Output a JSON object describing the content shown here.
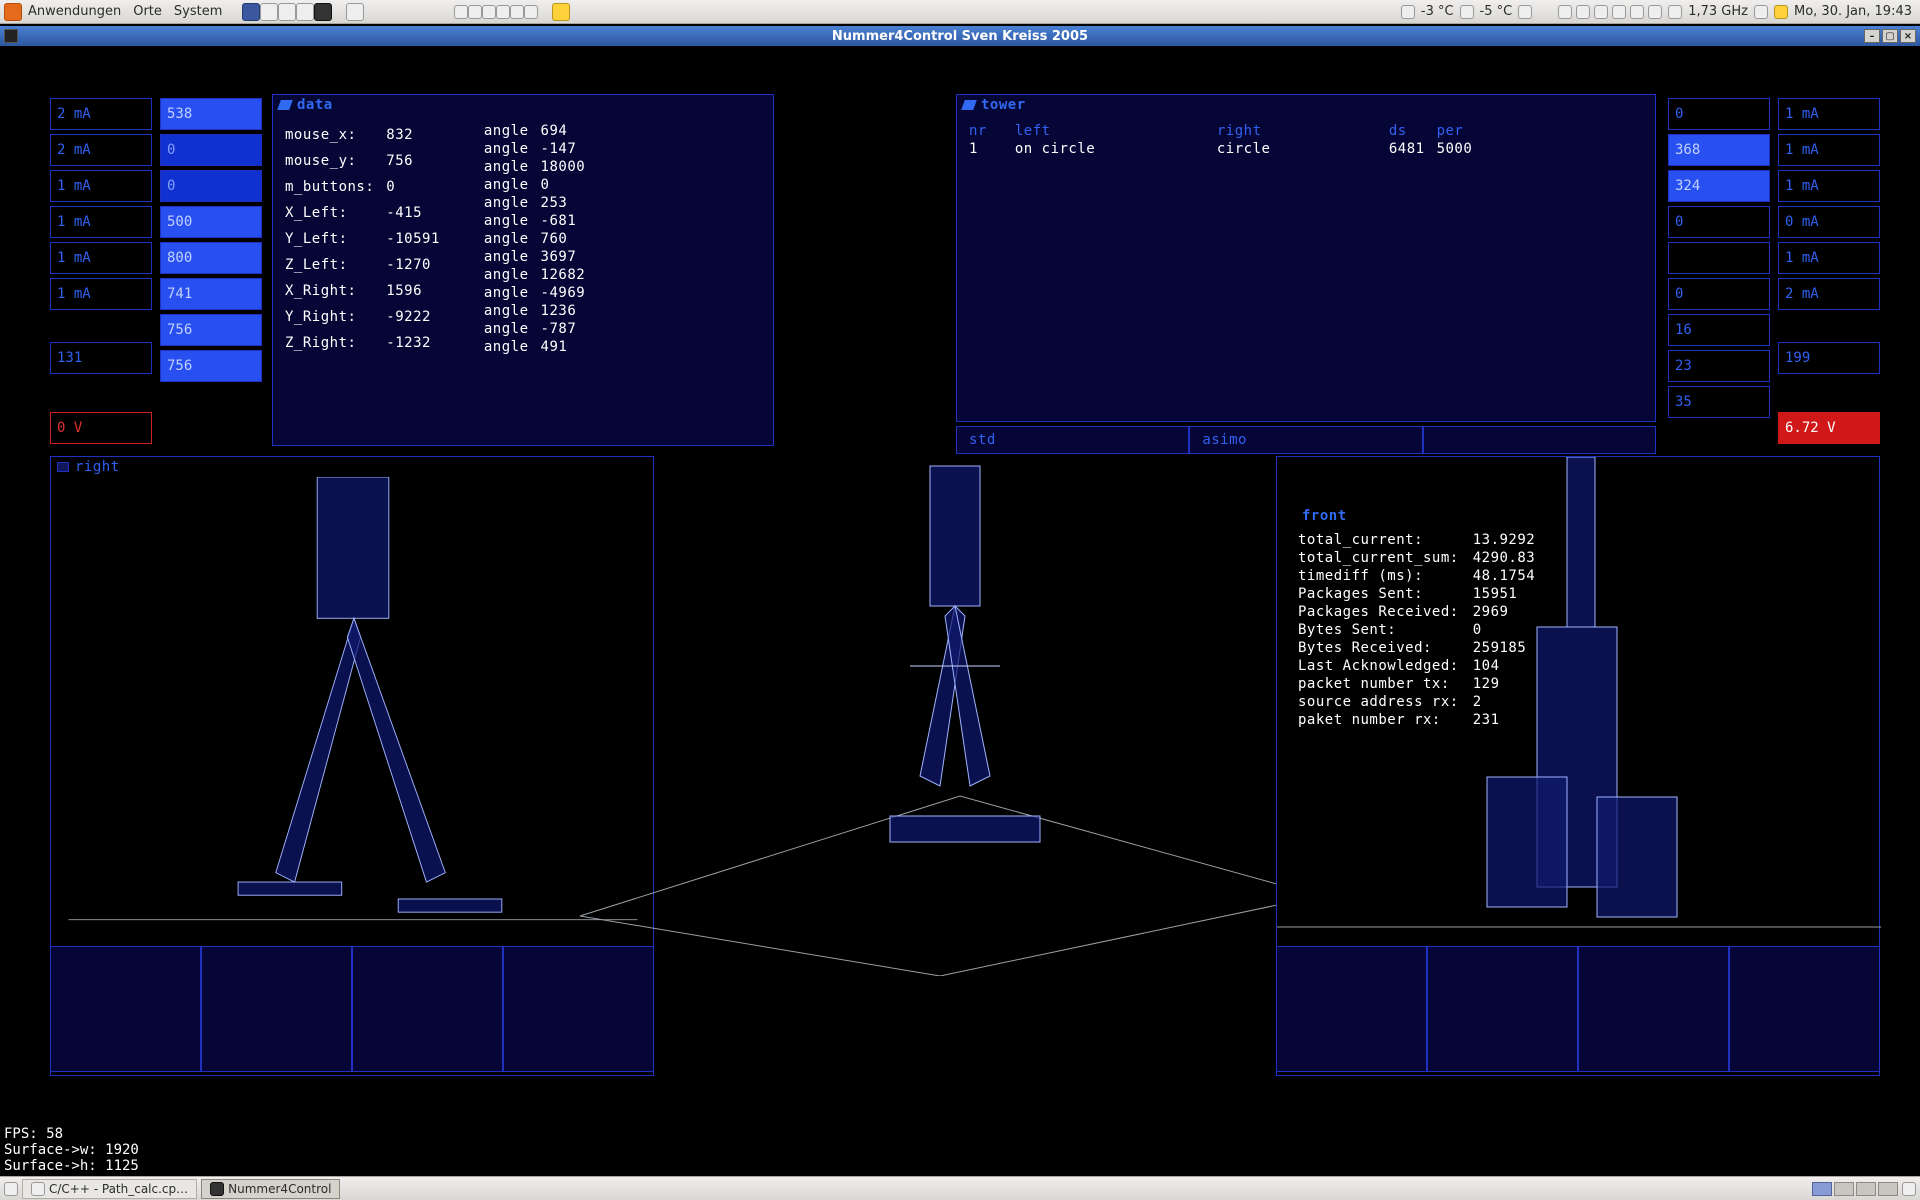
{
  "top_panel": {
    "menu_apps": "Anwendungen",
    "menu_places": "Orte",
    "menu_system": "System",
    "temp1": "-3 °C",
    "temp2": "-5 °C",
    "cpu_freq": "1,73 GHz",
    "clock": "Mo, 30. Jan, 19:43"
  },
  "titlebar": {
    "text": "Nummer4Control     Sven Kreiss 2005"
  },
  "left_buttons_a": [
    {
      "label": "2 mA",
      "style": "sbtn"
    },
    {
      "label": "2 mA",
      "style": "sbtn"
    },
    {
      "label": "1 mA",
      "style": "sbtn"
    },
    {
      "label": "1 mA",
      "style": "sbtn"
    },
    {
      "label": "1 mA",
      "style": "sbtn"
    },
    {
      "label": "1 mA",
      "style": "sbtn"
    }
  ],
  "left_buttons_b": [
    {
      "label": "131",
      "style": "sbtn"
    }
  ],
  "left_buttons_c": [
    {
      "label": "0 V",
      "style": "sbtn red-border"
    }
  ],
  "left_fill_col": [
    {
      "label": "538",
      "style": "sbtn fill-bright"
    },
    {
      "label": "0",
      "style": "sbtn fill"
    },
    {
      "label": "0",
      "style": "sbtn fill"
    },
    {
      "label": "500",
      "style": "sbtn fill-bright"
    },
    {
      "label": "800",
      "style": "sbtn fill-bright"
    },
    {
      "label": "741",
      "style": "sbtn fill-bright"
    },
    {
      "label": "756",
      "style": "sbtn fill-bright"
    },
    {
      "label": "756",
      "style": "sbtn fill-bright"
    }
  ],
  "data_panel": {
    "title": "data",
    "rows_left": [
      [
        "mouse_x:",
        "832"
      ],
      [
        "mouse_y:",
        "756"
      ],
      [
        "m_buttons:",
        "0"
      ],
      [
        "X_Left:",
        "-415"
      ],
      [
        "Y_Left:",
        "-10591"
      ],
      [
        "Z_Left:",
        "-1270"
      ],
      [
        "X_Right:",
        "1596"
      ],
      [
        "Y_Right:",
        "-9222"
      ],
      [
        "Z_Right:",
        "-1232"
      ]
    ],
    "rows_right": [
      [
        "angle",
        "694"
      ],
      [
        "angle",
        "-147"
      ],
      [
        "angle",
        "18000"
      ],
      [
        "angle",
        "0"
      ],
      [
        "angle",
        "253"
      ],
      [
        "angle",
        "-681"
      ],
      [
        "angle",
        "760"
      ],
      [
        "angle",
        "3697"
      ],
      [
        "angle",
        "12682"
      ],
      [
        "angle",
        "-4969"
      ],
      [
        "angle",
        "1236"
      ],
      [
        "angle",
        "-787"
      ],
      [
        "angle",
        "491"
      ]
    ]
  },
  "tower_panel": {
    "title": "tower",
    "headers": [
      "nr",
      "left",
      "right",
      "ds",
      "per"
    ],
    "row": [
      "1",
      "on circle",
      "circle",
      "6481",
      "5000"
    ]
  },
  "mode_buttons": [
    "std",
    "asimo",
    ""
  ],
  "right_buttons_left": [
    {
      "label": "0",
      "style": "sbtn"
    },
    {
      "label": "368",
      "style": "sbtn fill-bright"
    },
    {
      "label": "324",
      "style": "sbtn fill-bright"
    },
    {
      "label": "0",
      "style": "sbtn"
    },
    {
      "label": "",
      "style": "sbtn"
    },
    {
      "label": "0",
      "style": "sbtn"
    },
    {
      "label": "16",
      "style": "sbtn"
    },
    {
      "label": "23",
      "style": "sbtn"
    },
    {
      "label": "35",
      "style": "sbtn"
    }
  ],
  "right_buttons_right": [
    {
      "label": "1 mA",
      "style": "sbtn"
    },
    {
      "label": "1 mA",
      "style": "sbtn"
    },
    {
      "label": "1 mA",
      "style": "sbtn"
    },
    {
      "label": "0 mA",
      "style": "sbtn"
    },
    {
      "label": "1 mA",
      "style": "sbtn"
    },
    {
      "label": "2 mA",
      "style": "sbtn"
    }
  ],
  "right_buttons_extra": [
    {
      "label": "199",
      "style": "sbtn"
    }
  ],
  "right_voltage": {
    "label": "6.72 V",
    "style": "sbtn red-fill"
  },
  "viewports": {
    "left_title": "right",
    "front_title": "front"
  },
  "front_stats": {
    "rows": [
      [
        "total_current:",
        "13.9292"
      ],
      [
        "total_current_sum:",
        "4290.83"
      ],
      [
        "timediff (ms):",
        "48.1754"
      ],
      [
        "Packages Sent:",
        "15951"
      ],
      [
        "Packages Received:",
        "2969"
      ],
      [
        "Bytes Sent:",
        "0"
      ],
      [
        "Bytes Received:",
        "259185"
      ],
      [
        "Last Acknowledged:",
        "104"
      ],
      [
        "packet number tx:",
        "129"
      ],
      [
        "source address rx:",
        "2"
      ],
      [
        "paket number rx:",
        "231"
      ]
    ]
  },
  "surface": {
    "fps": "FPS: 58",
    "w": "Surface->w: 1920",
    "h": "Surface->h: 1125"
  },
  "bottom_panel": {
    "task1": "C/C++ - Path_calc.cp…",
    "task2": "Nummer4Control"
  }
}
